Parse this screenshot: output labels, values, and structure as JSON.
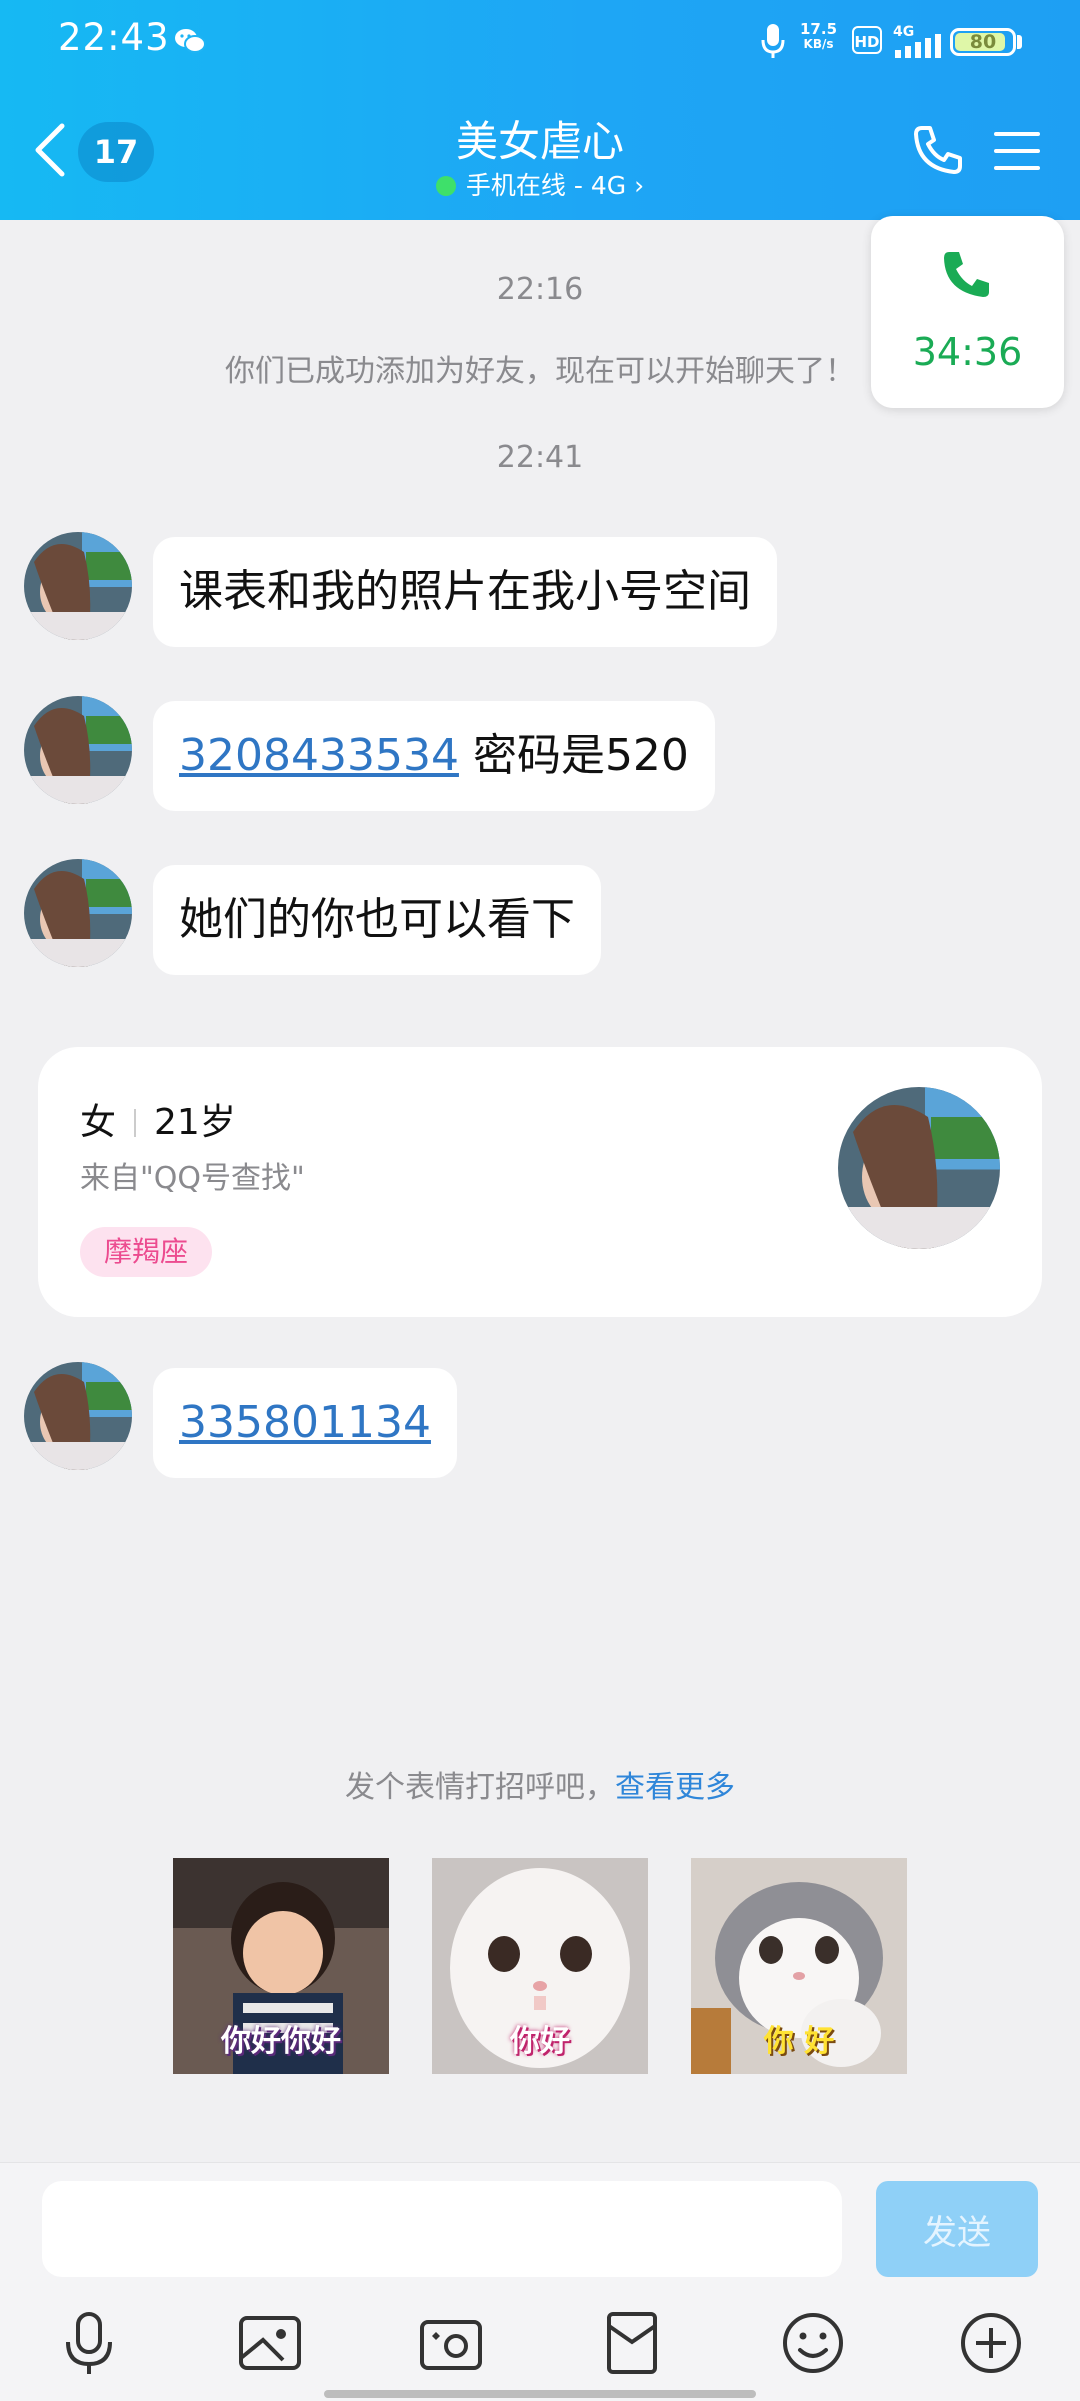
{
  "status_bar": {
    "time": "22:43",
    "net_speed_value": "17.5",
    "net_speed_unit": "KB/s",
    "hd": "HD",
    "network": "4G",
    "battery": "80"
  },
  "header": {
    "unread_count": "17",
    "title": "美女虐心",
    "online_status": "手机在线 - 4G",
    "chevron": "›"
  },
  "call": {
    "duration": "34:36"
  },
  "messages": {
    "time_1": "22:16",
    "system_notice": "你们已成功添加为好友，现在可以开始聊天了！",
    "time_2": "22:41",
    "msg_1": "课表和我的照片在我小号空间",
    "msg_2_link": "3208433534",
    "msg_2_text": " 密码是520",
    "msg_3": "她们的你也可以看下",
    "msg_4_link": "335801134"
  },
  "profile": {
    "gender": "女",
    "age": "21岁",
    "source": "来自\"QQ号查找\"",
    "zodiac": "摩羯座"
  },
  "greeting": {
    "tip": "发个表情打招呼吧，",
    "more_link": "查看更多"
  },
  "stickers": [
    {
      "caption": "你好你好"
    },
    {
      "caption": "你好"
    },
    {
      "caption": "你 好"
    }
  ],
  "input": {
    "value": "",
    "send_label": "发送"
  },
  "toolbar_icons": [
    "microphone-icon",
    "image-icon",
    "camera-icon",
    "red-packet-icon",
    "emoji-icon",
    "plus-icon"
  ],
  "colors": {
    "header": "#1ea6f5",
    "link": "#2f76c4",
    "call_green": "#1aab55",
    "send_disabled": "#8fd0f7"
  }
}
